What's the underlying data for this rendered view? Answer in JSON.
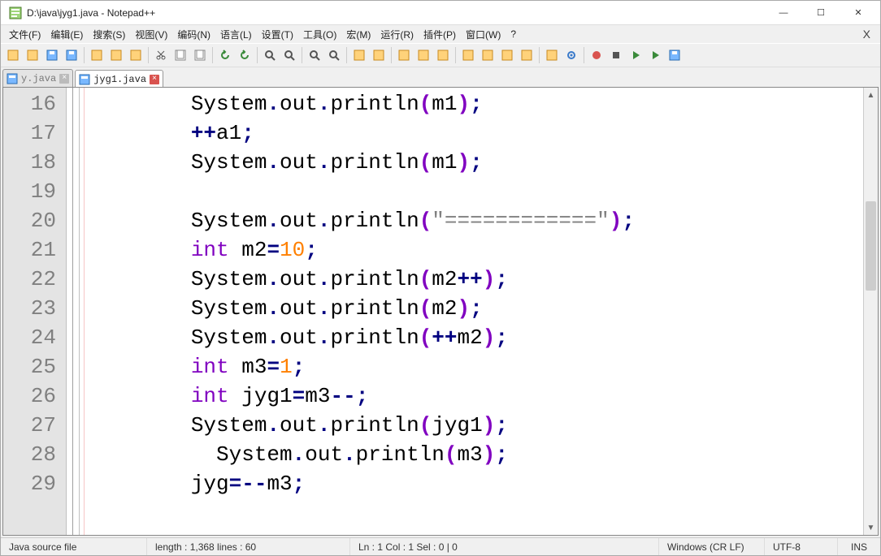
{
  "window": {
    "title": "D:\\java\\jyg1.java - Notepad++",
    "min_icon": "—",
    "max_icon": "☐",
    "close_icon": "✕"
  },
  "menubar": {
    "file": "文件(F)",
    "edit": "编辑(E)",
    "search": "搜索(S)",
    "view": "视图(V)",
    "encoding": "编码(N)",
    "language": "语言(L)",
    "settings": "设置(T)",
    "tools": "工具(O)",
    "macro": "宏(M)",
    "run": "运行(R)",
    "plugins": "插件(P)",
    "window": "窗口(W)",
    "help": "?",
    "close_x": "X"
  },
  "tabs": [
    {
      "label": "y.java",
      "active": false
    },
    {
      "label": "jyg1.java",
      "active": true
    }
  ],
  "gutter_start": 16,
  "gutter_end": 29,
  "code_lines": [
    {
      "indent": "        ",
      "tokens": [
        {
          "t": "System",
          "c": ""
        },
        {
          "t": ".",
          "c": "k-op"
        },
        {
          "t": "out",
          "c": ""
        },
        {
          "t": ".",
          "c": "k-op"
        },
        {
          "t": "println",
          "c": ""
        },
        {
          "t": "(",
          "c": "k-paren"
        },
        {
          "t": "m1",
          "c": ""
        },
        {
          "t": ")",
          "c": "k-paren"
        },
        {
          "t": ";",
          "c": "k-op"
        }
      ]
    },
    {
      "indent": "        ",
      "tokens": [
        {
          "t": "++",
          "c": "k-op"
        },
        {
          "t": "a1",
          "c": ""
        },
        {
          "t": ";",
          "c": "k-op"
        }
      ]
    },
    {
      "indent": "        ",
      "tokens": [
        {
          "t": "System",
          "c": ""
        },
        {
          "t": ".",
          "c": "k-op"
        },
        {
          "t": "out",
          "c": ""
        },
        {
          "t": ".",
          "c": "k-op"
        },
        {
          "t": "println",
          "c": ""
        },
        {
          "t": "(",
          "c": "k-paren"
        },
        {
          "t": "m1",
          "c": ""
        },
        {
          "t": ")",
          "c": "k-paren"
        },
        {
          "t": ";",
          "c": "k-op"
        }
      ]
    },
    {
      "indent": "",
      "tokens": []
    },
    {
      "indent": "        ",
      "tokens": [
        {
          "t": "System",
          "c": ""
        },
        {
          "t": ".",
          "c": "k-op"
        },
        {
          "t": "out",
          "c": ""
        },
        {
          "t": ".",
          "c": "k-op"
        },
        {
          "t": "println",
          "c": ""
        },
        {
          "t": "(",
          "c": "k-paren"
        },
        {
          "t": "\"============\"",
          "c": "k-str"
        },
        {
          "t": ")",
          "c": "k-paren"
        },
        {
          "t": ";",
          "c": "k-op"
        }
      ]
    },
    {
      "indent": "        ",
      "tokens": [
        {
          "t": "int",
          "c": "k-int"
        },
        {
          "t": " m2",
          "c": ""
        },
        {
          "t": "=",
          "c": "k-op"
        },
        {
          "t": "10",
          "c": "k-num"
        },
        {
          "t": ";",
          "c": "k-op"
        }
      ]
    },
    {
      "indent": "        ",
      "tokens": [
        {
          "t": "System",
          "c": ""
        },
        {
          "t": ".",
          "c": "k-op"
        },
        {
          "t": "out",
          "c": ""
        },
        {
          "t": ".",
          "c": "k-op"
        },
        {
          "t": "println",
          "c": ""
        },
        {
          "t": "(",
          "c": "k-paren"
        },
        {
          "t": "m2",
          "c": ""
        },
        {
          "t": "++",
          "c": "k-op"
        },
        {
          "t": ")",
          "c": "k-paren"
        },
        {
          "t": ";",
          "c": "k-op"
        }
      ]
    },
    {
      "indent": "        ",
      "tokens": [
        {
          "t": "System",
          "c": ""
        },
        {
          "t": ".",
          "c": "k-op"
        },
        {
          "t": "out",
          "c": ""
        },
        {
          "t": ".",
          "c": "k-op"
        },
        {
          "t": "println",
          "c": ""
        },
        {
          "t": "(",
          "c": "k-paren"
        },
        {
          "t": "m2",
          "c": ""
        },
        {
          "t": ")",
          "c": "k-paren"
        },
        {
          "t": ";",
          "c": "k-op"
        }
      ]
    },
    {
      "indent": "        ",
      "tokens": [
        {
          "t": "System",
          "c": ""
        },
        {
          "t": ".",
          "c": "k-op"
        },
        {
          "t": "out",
          "c": ""
        },
        {
          "t": ".",
          "c": "k-op"
        },
        {
          "t": "println",
          "c": ""
        },
        {
          "t": "(",
          "c": "k-paren"
        },
        {
          "t": "++",
          "c": "k-op"
        },
        {
          "t": "m2",
          "c": ""
        },
        {
          "t": ")",
          "c": "k-paren"
        },
        {
          "t": ";",
          "c": "k-op"
        }
      ]
    },
    {
      "indent": "        ",
      "tokens": [
        {
          "t": "int",
          "c": "k-int"
        },
        {
          "t": " m3",
          "c": ""
        },
        {
          "t": "=",
          "c": "k-op"
        },
        {
          "t": "1",
          "c": "k-num"
        },
        {
          "t": ";",
          "c": "k-op"
        }
      ]
    },
    {
      "indent": "        ",
      "tokens": [
        {
          "t": "int",
          "c": "k-int"
        },
        {
          "t": " jyg1",
          "c": ""
        },
        {
          "t": "=",
          "c": "k-op"
        },
        {
          "t": "m3",
          "c": ""
        },
        {
          "t": "--",
          "c": "k-op"
        },
        {
          "t": ";",
          "c": "k-op"
        }
      ]
    },
    {
      "indent": "        ",
      "tokens": [
        {
          "t": "System",
          "c": ""
        },
        {
          "t": ".",
          "c": "k-op"
        },
        {
          "t": "out",
          "c": ""
        },
        {
          "t": ".",
          "c": "k-op"
        },
        {
          "t": "println",
          "c": ""
        },
        {
          "t": "(",
          "c": "k-paren"
        },
        {
          "t": "jyg1",
          "c": ""
        },
        {
          "t": ")",
          "c": "k-paren"
        },
        {
          "t": ";",
          "c": "k-op"
        }
      ]
    },
    {
      "indent": "          ",
      "tokens": [
        {
          "t": "System",
          "c": ""
        },
        {
          "t": ".",
          "c": "k-op"
        },
        {
          "t": "out",
          "c": ""
        },
        {
          "t": ".",
          "c": "k-op"
        },
        {
          "t": "println",
          "c": ""
        },
        {
          "t": "(",
          "c": "k-paren"
        },
        {
          "t": "m3",
          "c": ""
        },
        {
          "t": ")",
          "c": "k-paren"
        },
        {
          "t": ";",
          "c": "k-op"
        }
      ]
    },
    {
      "indent": "        ",
      "tokens": [
        {
          "t": "jyg",
          "c": ""
        },
        {
          "t": "=--",
          "c": "k-op"
        },
        {
          "t": "m3",
          "c": ""
        },
        {
          "t": ";",
          "c": "k-op"
        }
      ]
    }
  ],
  "statusbar": {
    "filetype": "Java source file",
    "length": "length : 1,368    lines : 60",
    "pos": "Ln : 1    Col : 1    Sel : 0 | 0",
    "eol": "Windows (CR LF)",
    "encoding": "UTF-8",
    "ins": "INS"
  },
  "toolbar_icons": [
    "new-file-icon",
    "open-file-icon",
    "save-icon",
    "save-all-icon",
    "sep",
    "close-icon",
    "close-all-icon",
    "print-icon",
    "sep",
    "cut-icon",
    "copy-icon",
    "paste-icon",
    "sep",
    "undo-icon",
    "redo-icon",
    "sep",
    "find-icon",
    "replace-icon",
    "sep",
    "zoom-in-icon",
    "zoom-out-icon",
    "sep",
    "sync-v-icon",
    "sync-h-icon",
    "sep",
    "wrap-icon",
    "show-all-icon",
    "indent-guide-icon",
    "sep",
    "lang-icon",
    "doc-map-icon",
    "doc-list-icon",
    "function-list-icon",
    "sep",
    "folder-icon",
    "monitor-icon",
    "sep",
    "record-icon",
    "stop-icon",
    "play-icon",
    "play-multi-icon",
    "save-macro-icon"
  ]
}
